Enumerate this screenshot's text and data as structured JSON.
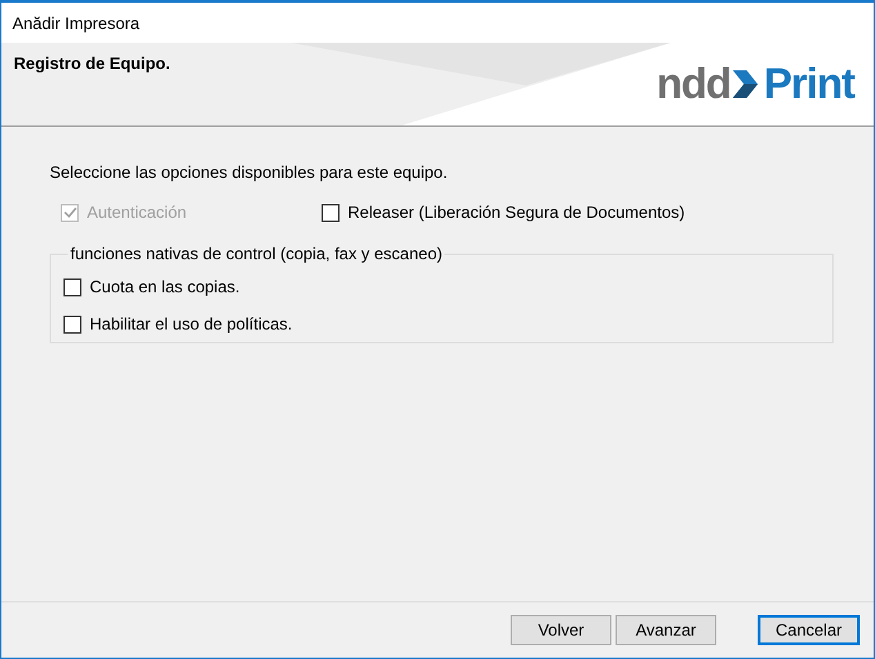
{
  "window": {
    "title": "Anădir Impresora"
  },
  "header": {
    "title": "Registro de Equipo.",
    "logo": {
      "left": "ndd",
      "right": "Print"
    }
  },
  "instruction": "Seleccione las opciones disponibles para este equipo.",
  "options": [
    {
      "label": "Autenticación",
      "checked": true,
      "disabled": true
    },
    {
      "label": "Releaser (Liberación Segura de Documentos)",
      "checked": false,
      "disabled": false
    }
  ],
  "group": {
    "legend": "funciones nativas de control (copia, fax y escaneo)",
    "options": [
      {
        "label": "Cuota en las copias.",
        "checked": false,
        "disabled": false
      },
      {
        "label": "Habilitar el uso de políticas.",
        "checked": false,
        "disabled": false
      }
    ]
  },
  "buttons": [
    {
      "label": "Volver",
      "default": false
    },
    {
      "label": "Avanzar",
      "default": false
    },
    {
      "label": "Cancelar",
      "default": true
    }
  ]
}
